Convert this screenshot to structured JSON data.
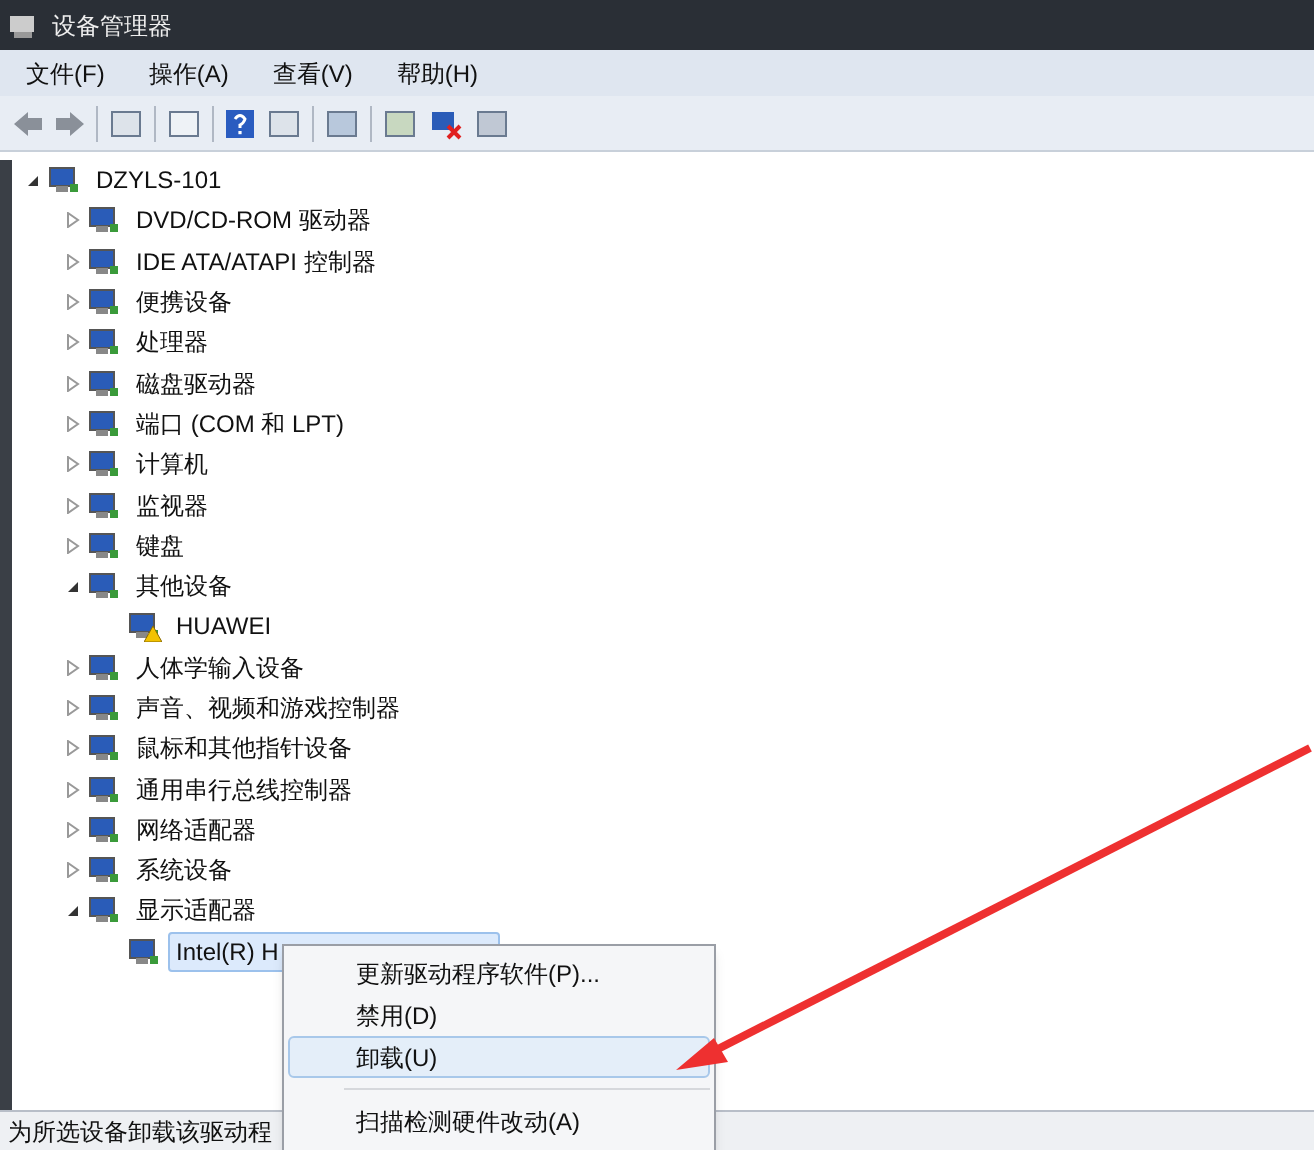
{
  "window": {
    "title": "设备管理器"
  },
  "menu_bar": [
    "文件(F)",
    "操作(A)",
    "查看(V)",
    "帮助(H)"
  ],
  "tree": {
    "label": "DZYLS-101",
    "expanded": true,
    "children": [
      {
        "label": "DVD/CD-ROM 驱动器",
        "expanded": false
      },
      {
        "label": "IDE ATA/ATAPI 控制器",
        "expanded": false
      },
      {
        "label": "便携设备",
        "expanded": false
      },
      {
        "label": "处理器",
        "expanded": false
      },
      {
        "label": "磁盘驱动器",
        "expanded": false
      },
      {
        "label": "端口 (COM 和 LPT)",
        "expanded": false
      },
      {
        "label": "计算机",
        "expanded": false
      },
      {
        "label": "监视器",
        "expanded": false
      },
      {
        "label": "键盘",
        "expanded": false
      },
      {
        "label": "其他设备",
        "expanded": true,
        "children": [
          {
            "label": "HUAWEI",
            "warning": true,
            "selected": false
          }
        ]
      },
      {
        "label": "人体学输入设备",
        "expanded": false
      },
      {
        "label": "声音、视频和游戏控制器",
        "expanded": false
      },
      {
        "label": "鼠标和其他指针设备",
        "expanded": false
      },
      {
        "label": "通用串行总线控制器",
        "expanded": false
      },
      {
        "label": "网络适配器",
        "expanded": false
      },
      {
        "label": "系统设备",
        "expanded": false
      },
      {
        "label": "显示适配器",
        "expanded": true,
        "children": [
          {
            "label": "Intel(R) H",
            "warning": false,
            "selected": true
          }
        ]
      }
    ]
  },
  "context_menu": [
    {
      "label": "更新驱动程序软件(P)...",
      "selected": false
    },
    {
      "label": "禁用(D)",
      "selected": false
    },
    {
      "label": "卸载(U)",
      "selected": true
    },
    {
      "label": "扫描检测硬件改动(A)",
      "selected": false,
      "separator_before": true
    }
  ],
  "status_bar": "为所选设备卸载该驱动程"
}
